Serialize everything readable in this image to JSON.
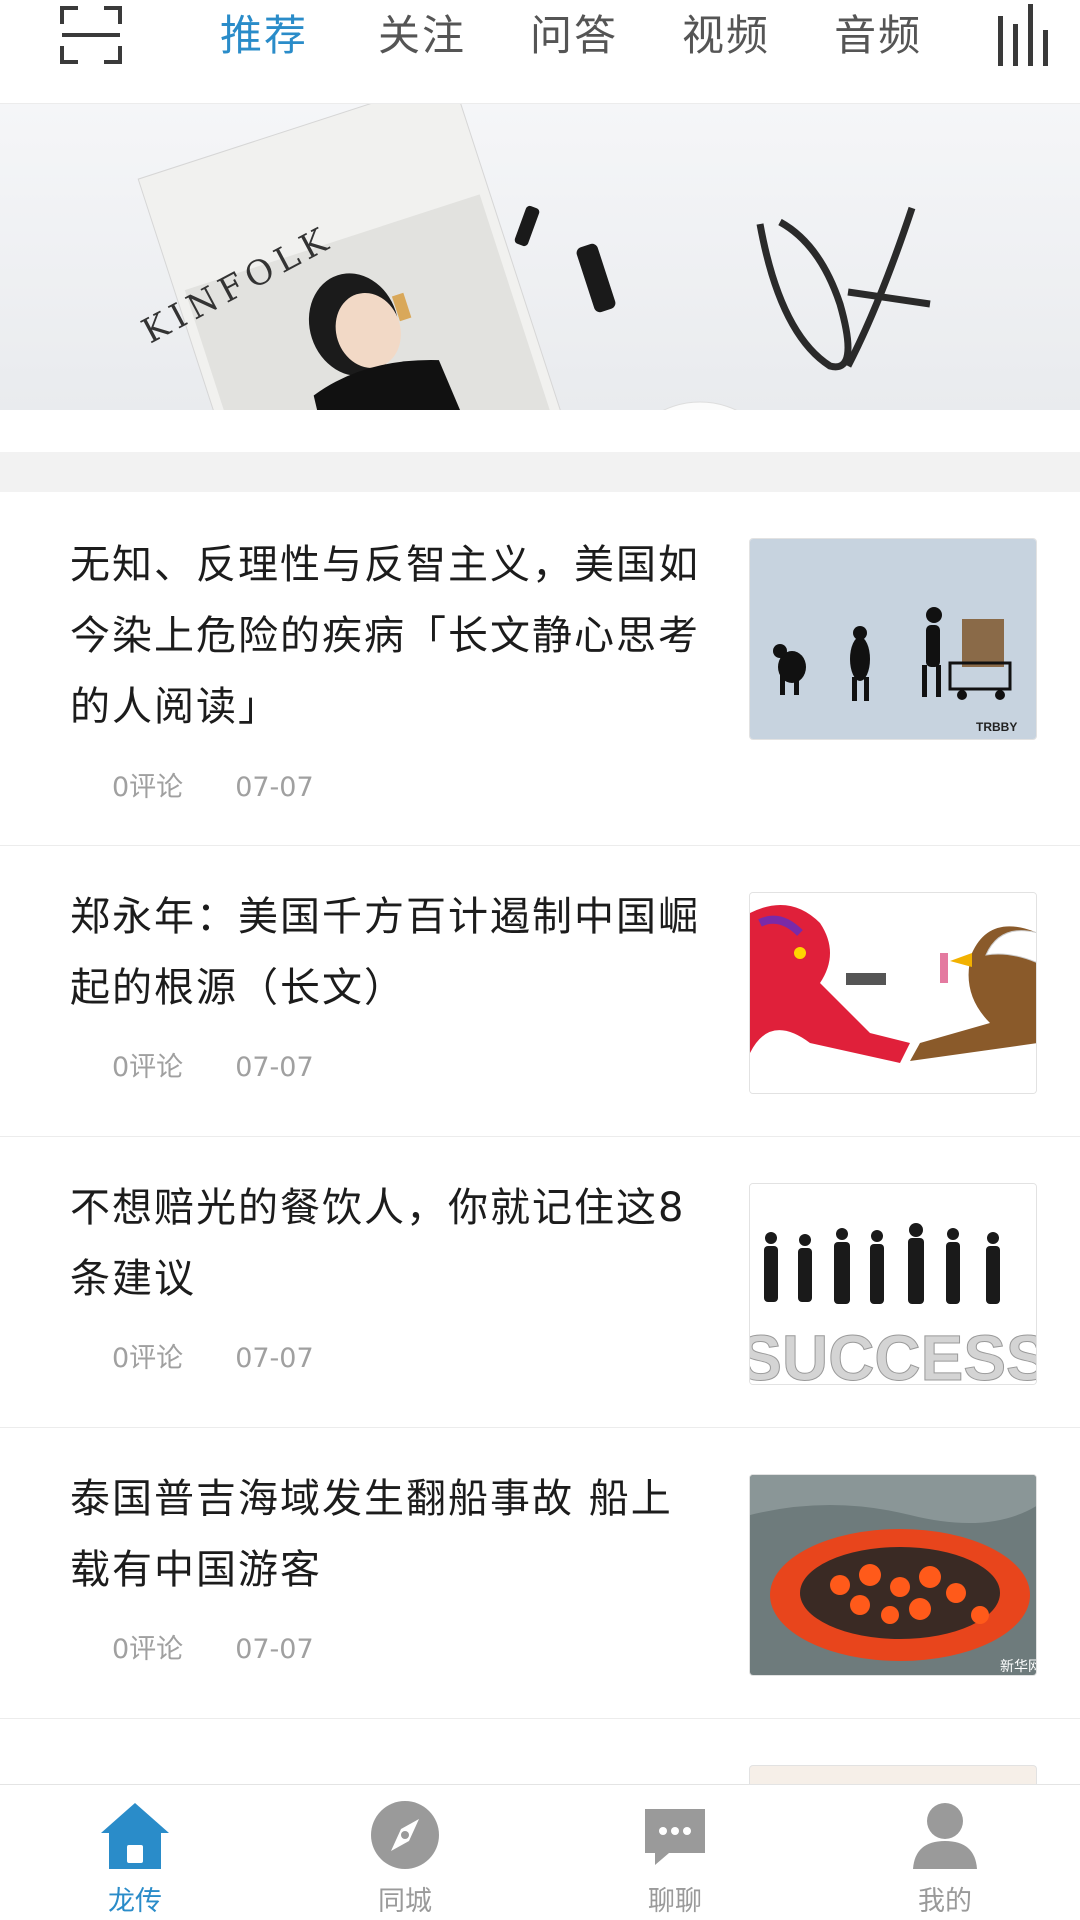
{
  "topbar": {
    "tabs": [
      {
        "label": "推荐",
        "active": true
      },
      {
        "label": "关注",
        "active": false
      },
      {
        "label": "问答",
        "active": false
      },
      {
        "label": "视频",
        "active": false
      },
      {
        "label": "音频",
        "active": false
      }
    ],
    "scan_icon": "scan-frame-icon",
    "channels_icon": "channel-bars-icon"
  },
  "banner": {
    "magazine_title": "KINFOLK"
  },
  "feed": [
    {
      "title": "无知、反理性与反智主义，美国如今染上危险的疾病「长文静心思考的人阅读」",
      "comments": "0评论",
      "date": "07-07",
      "thumb": "evolution",
      "thumb_text": "TRBBY"
    },
    {
      "title": "郑永年：美国千方百计遏制中国崛起的根源（长文）",
      "comments": "0评论",
      "date": "07-07",
      "thumb": "dragon-eagle"
    },
    {
      "title": "不想赔光的餐饮人，你就记住这8条建议",
      "comments": "0评论",
      "date": "07-07",
      "thumb": "success",
      "thumb_text": "SUCCESS"
    },
    {
      "title": "泰国普吉海域发生翻船事故 船上载有中国游客",
      "comments": "0评论",
      "date": "07-07",
      "thumb": "liferaft",
      "thumb_text": "新华网"
    }
  ],
  "bottom_nav": [
    {
      "label": "龙传",
      "icon": "home-icon",
      "active": true
    },
    {
      "label": "同城",
      "icon": "compass-icon",
      "active": false
    },
    {
      "label": "聊聊",
      "icon": "chat-icon",
      "active": false
    },
    {
      "label": "我的",
      "icon": "user-icon",
      "active": false
    }
  ],
  "colors": {
    "accent": "#2a8cc9",
    "inactive": "#9a9a9a",
    "title": "#1c1c1c",
    "meta": "#a0a0a0",
    "separator": "#f2f2f2"
  }
}
